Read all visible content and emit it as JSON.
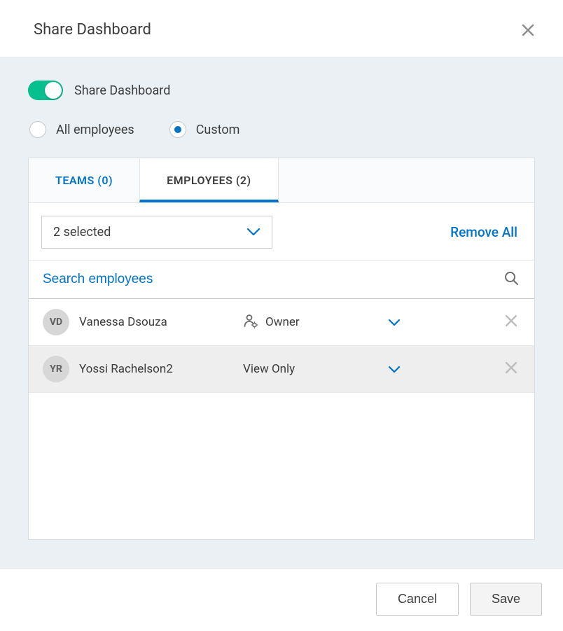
{
  "header": {
    "title": "Share Dashboard"
  },
  "toggle": {
    "label": "Share Dashboard",
    "on": true
  },
  "scope": {
    "options": [
      {
        "label": "All employees",
        "checked": false
      },
      {
        "label": "Custom",
        "checked": true
      }
    ]
  },
  "tabs": [
    {
      "label": "TEAMS (0)",
      "active": false
    },
    {
      "label": "EMPLOYEES (2)",
      "active": true
    }
  ],
  "filter": {
    "select_label": "2 selected",
    "remove_all_label": "Remove All"
  },
  "search": {
    "placeholder": "Search employees",
    "value": ""
  },
  "employees": [
    {
      "initials": "VD",
      "name": "Vanessa Dsouza",
      "role": "Owner",
      "role_icon": "owner"
    },
    {
      "initials": "YR",
      "name": "Yossi Rachelson2",
      "role": "View Only",
      "role_icon": null
    }
  ],
  "footer": {
    "cancel_label": "Cancel",
    "save_label": "Save"
  }
}
